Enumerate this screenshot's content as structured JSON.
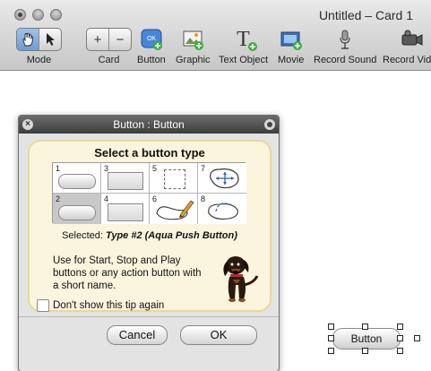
{
  "window": {
    "title": "Untitled – Card 1"
  },
  "toolbar": {
    "mode_label": "Mode",
    "card_label": "Card",
    "button_label": "Button",
    "button_icon_text": "OK",
    "graphic_label": "Graphic",
    "text_object_label": "Text Object",
    "movie_label": "Movie",
    "record_sound_label": "Record Sound",
    "record_video_label": "Record Video",
    "card_add_symbol": "+",
    "card_remove_symbol": "−",
    "text_icon_glyph": "T"
  },
  "dialog": {
    "title": "Button : Button",
    "close_glyph": "×",
    "heading": "Select a button type",
    "types": [
      {
        "num": "1"
      },
      {
        "num": "3"
      },
      {
        "num": "5"
      },
      {
        "num": "7"
      },
      {
        "num": "2"
      },
      {
        "num": "4"
      },
      {
        "num": "6"
      },
      {
        "num": "8"
      }
    ],
    "selected_prefix": "Selected:",
    "selected_value": "Type #2 (Aqua Push Button)",
    "description": "Use for Start, Stop and Play buttons or any action button with a short name.",
    "checkbox_label": "Don't show this tip again",
    "cancel_label": "Cancel",
    "ok_label": "OK"
  },
  "stage": {
    "button_label": "Button"
  }
}
